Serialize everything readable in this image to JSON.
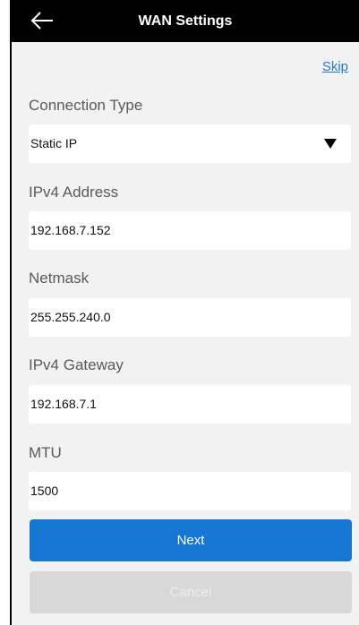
{
  "header": {
    "title": "WAN Settings",
    "back_icon": "arrow-left-icon"
  },
  "skip_label": "Skip",
  "form": {
    "connection_type": {
      "label": "Connection Type",
      "value": "Static IP",
      "dropdown_icon": "caret-down-icon"
    },
    "ipv4_address": {
      "label": "IPv4 Address",
      "value": "192.168.7.152"
    },
    "netmask": {
      "label": "Netmask",
      "value": "255.255.240.0"
    },
    "ipv4_gateway": {
      "label": "IPv4 Gateway",
      "value": "192.168.7.1"
    },
    "mtu": {
      "label": "MTU",
      "value": "1500"
    }
  },
  "buttons": {
    "next_label": "Next",
    "cancel_label": "Cancel"
  },
  "colors": {
    "header_bg": "#000000",
    "accent": "#1677d2",
    "link": "#2a78c8",
    "disabled_button": "#d8d8d8",
    "background": "#f2f2f2"
  }
}
